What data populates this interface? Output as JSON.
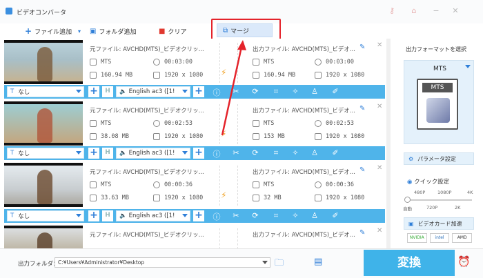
{
  "app": {
    "title": "ビデオコンバータ"
  },
  "toolbar": {
    "add_file": "ファイル追加",
    "add_folder": "フォルダ追加",
    "clear": "クリア",
    "merge": "マージ"
  },
  "rows": [
    {
      "src_file": "元ファイル: AVCHD(MTS)_ビデオクリッ...",
      "out_file": "出力ファイル: AVCHD(MTS)_ビデオ...",
      "src_fmt": "MTS",
      "src_dur": "00:03:00",
      "src_size": "160.94 MB",
      "src_res": "1920 x 1080",
      "out_fmt": "MTS",
      "out_dur": "00:03:00",
      "out_size": "160.94 MB",
      "out_res": "1920 x 1080",
      "subtitle": "なし",
      "audio": "English ac3 ([1!"
    },
    {
      "src_file": "元ファイル: AVCHD(MTS)_ビデオクリッ...",
      "out_file": "出力ファイル: AVCHD(MTS)_ビデオ...",
      "src_fmt": "MTS",
      "src_dur": "00:02:53",
      "src_size": "38.08 MB",
      "src_res": "1920 x 1080",
      "out_fmt": "MTS",
      "out_dur": "00:02:53",
      "out_size": "153 MB",
      "out_res": "1920 x 1080",
      "subtitle": "なし",
      "audio": "English ac3 ([1!"
    },
    {
      "src_file": "元ファイル: AVCHD(MTS)_ビデオクリッ...",
      "out_file": "出力ファイル: AVCHD(MTS)_ビデオ...",
      "src_fmt": "MTS",
      "src_dur": "00:00:36",
      "src_size": "33.63 MB",
      "src_res": "1920 x 1080",
      "out_fmt": "MTS",
      "out_dur": "00:00:36",
      "out_size": "32 MB",
      "out_res": "1920 x 1080",
      "subtitle": "なし",
      "audio": "English ac3 ([1!"
    }
  ],
  "row4": {
    "src_file": "元ファイル: AVCHD(MTS)_ビデオクリッ...",
    "out_file": "出力ファイル: AVCHD(MTS)_ビデオ..."
  },
  "sidebar": {
    "select_format": "出力フォーマットを選択",
    "format": "MTS",
    "format_tag": "MTS",
    "params": "パラメータ設定",
    "quick": "クイック設定",
    "ticks_top": [
      "480P",
      "1080P",
      "4K"
    ],
    "ticks_bottom": [
      "自動",
      "720P",
      "2K"
    ],
    "gpu": "ビデオカード加速",
    "logos": [
      "NVIDIA",
      "intel",
      "AMD"
    ]
  },
  "footer": {
    "output_label": "出力フォルダ：",
    "path": "C:¥Users¥Administrator¥Desktop",
    "convert": "変換"
  },
  "colors": {
    "accent": "#3fb3e9",
    "highlight": "#e4232b",
    "bar": "#4fb4ea"
  }
}
